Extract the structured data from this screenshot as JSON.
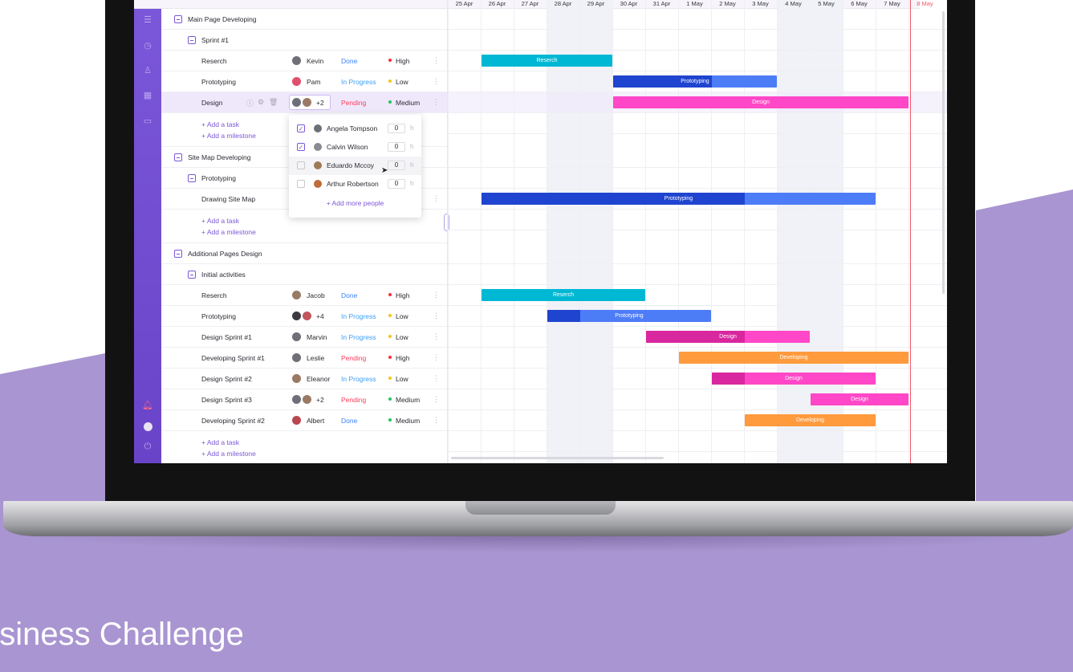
{
  "brand": {
    "purple": "#a995d1",
    "accent": "#7b57d9"
  },
  "days": [
    "25 Apr",
    "26 Apr",
    "27 Apr",
    "28 Apr",
    "29 Apr",
    "30 Apr",
    "31 Apr",
    "1 May",
    "2 May",
    "3 May",
    "4 May",
    "5 May",
    "6 May",
    "7 May",
    "8 May"
  ],
  "groups": {
    "g1": "Main Page Developing",
    "g1_s1": "Sprint #1",
    "g2": "Site Map Developing",
    "g2_s1": "Prototyping",
    "g3": "Additional Pages Design",
    "g3_s1": "Initial activities"
  },
  "tasks": [
    {
      "name": "Reserch",
      "assignee": "Kevin",
      "status": "Done",
      "priority": "High",
      "color": "#00b3cc"
    },
    {
      "name": "Prototyping",
      "assignee": "Pam",
      "status": "In Progress",
      "priority": "Low",
      "color": "#2c4fd6"
    },
    {
      "name": "Design",
      "assignee": "",
      "plus": "+2",
      "status": "Pending",
      "priority": "Medium",
      "color": "#ff44c4"
    },
    {
      "name": "Drawing Site Map",
      "assignee": "",
      "status": "",
      "priority": "",
      "color": "#2c4fd6"
    },
    {
      "name": "Reserch",
      "assignee": "Jacob",
      "status": "Done",
      "priority": "High",
      "color": "#00b3cc"
    },
    {
      "name": "Prototyping",
      "assignee": "",
      "plus": "+4",
      "status": "In Progress",
      "priority": "Low",
      "color": "#2c4fd6"
    },
    {
      "name": "Design Sprint #1",
      "assignee": "Marvin",
      "status": "In Progress",
      "priority": "Low",
      "color": "#e83fc0"
    },
    {
      "name": "Developing Sprint #1",
      "assignee": "Leslie",
      "status": "Pending",
      "priority": "High",
      "color": "#ff9a3d"
    },
    {
      "name": "Design Sprint #2",
      "assignee": "Eleanor",
      "status": "In Progress",
      "priority": "Low",
      "color": "#e83fc0"
    },
    {
      "name": "Design Sprint #3",
      "assignee": "",
      "plus": "+2",
      "status": "Pending",
      "priority": "Medium",
      "color": "#ff44c4"
    },
    {
      "name": "Developing Sprint #2",
      "assignee": "Albert",
      "status": "Done",
      "priority": "Medium",
      "color": "#ff9a3d"
    }
  ],
  "add_task": "+ Add a task",
  "add_milestone": "+ Add a milestone",
  "popup": {
    "people": [
      {
        "name": "Angela Tompson",
        "checked": true,
        "hours": "0"
      },
      {
        "name": "Calvin Wilson",
        "checked": true,
        "hours": "0"
      },
      {
        "name": "Eduardo Mccoy",
        "checked": false,
        "hours": "0"
      },
      {
        "name": "Arthur Robertson",
        "checked": false,
        "hours": "0"
      }
    ],
    "hours_unit": "h",
    "add_more": "+ Add more people"
  },
  "bars": {
    "b1": "Reserch",
    "b2": "Prototyping",
    "b3": "Design",
    "b4": "Prototyping",
    "b5": "Reserch",
    "b6": "Prototyping",
    "b7": "Design",
    "b8": "Developing",
    "b9": "Design",
    "b10": "Design",
    "b11": "Developing"
  },
  "caption": "usiness Challenge"
}
